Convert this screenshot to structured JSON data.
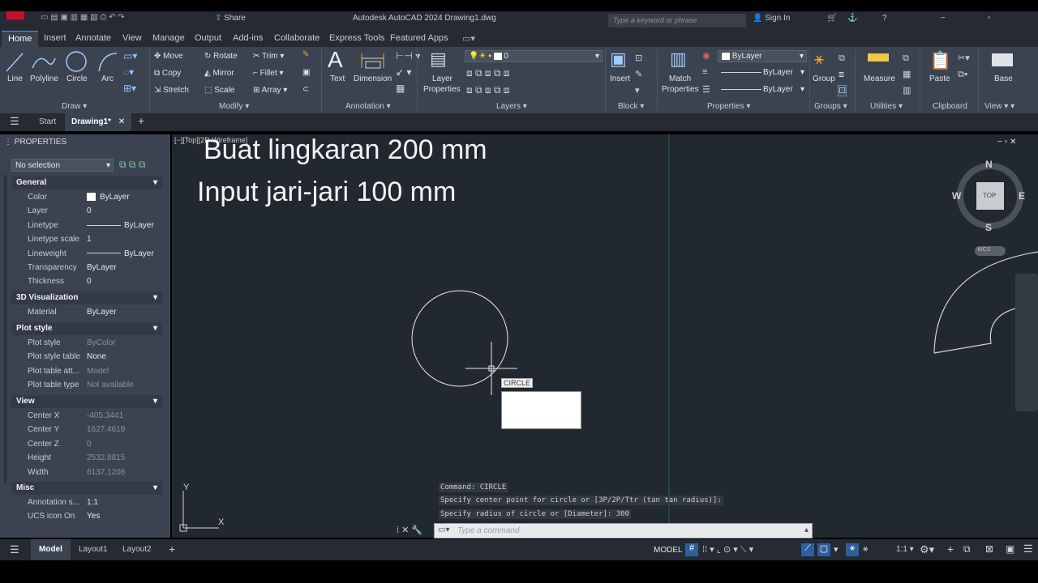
{
  "title_bar": {
    "share": "Share",
    "app_title": "Autodesk AutoCAD 2024   Drawing1.dwg",
    "search_placeholder": "Type a keyword or phrase",
    "sign_in": "Sign In"
  },
  "menu_tabs": [
    "Home",
    "Insert",
    "Annotate",
    "View",
    "Manage",
    "Output",
    "Add-ins",
    "Collaborate",
    "Express Tools",
    "Featured Apps"
  ],
  "ribbon": {
    "draw": {
      "line": "Line",
      "polyline": "Polyline",
      "circle": "Circle",
      "arc": "Arc",
      "title": "Draw"
    },
    "modify": {
      "move": "Move",
      "rotate": "Rotate",
      "trim": "Trim",
      "copy": "Copy",
      "mirror": "Mirror",
      "fillet": "Fillet",
      "stretch": "Stretch",
      "scale": "Scale",
      "array": "Array",
      "title": "Modify"
    },
    "annotation": {
      "text": "Text",
      "dimension": "Dimension",
      "title": "Annotation"
    },
    "layers": {
      "layer_properties_1": "Layer",
      "layer_properties_2": "Properties",
      "current_layer": "0",
      "title": "Layers"
    },
    "block": {
      "insert": "Insert",
      "title": "Block"
    },
    "properties": {
      "match_1": "Match",
      "match_2": "Properties",
      "color": "ByLayer",
      "linetype": "ByLayer",
      "lineweight": "ByLayer",
      "title": "Properties"
    },
    "groups": {
      "group": "Group",
      "title": "Groups"
    },
    "utilities": {
      "measure": "Measure",
      "title": "Utilities"
    },
    "clipboard": {
      "paste": "Paste",
      "title": "Clipboard"
    },
    "view": {
      "base": "Base",
      "title": "View"
    }
  },
  "doc_tabs": {
    "start": "Start",
    "drawing": "Drawing1*"
  },
  "properties": {
    "title": "PROPERTIES",
    "selection": "No selection",
    "general": {
      "title": "General",
      "rows": [
        [
          "Color",
          "ByLayer"
        ],
        [
          "Layer",
          "0"
        ],
        [
          "Linetype",
          "ByLayer"
        ],
        [
          "Linetype scale",
          "1"
        ],
        [
          "Lineweight",
          "ByLayer"
        ],
        [
          "Transparency",
          "ByLayer"
        ],
        [
          "Thickness",
          "0"
        ]
      ]
    },
    "viz": {
      "title": "3D Visualization",
      "rows": [
        [
          "Material",
          "ByLayer"
        ]
      ]
    },
    "plot": {
      "title": "Plot style",
      "rows": [
        [
          "Plot style",
          "ByColor"
        ],
        [
          "Plot style table",
          "None"
        ],
        [
          "Plot table att...",
          "Model"
        ],
        [
          "Plot table type",
          "Not available"
        ]
      ]
    },
    "view": {
      "title": "View",
      "rows": [
        [
          "Center X",
          "-405.3441"
        ],
        [
          "Center Y",
          "1627.4619"
        ],
        [
          "Center Z",
          "0"
        ],
        [
          "Height",
          "2532.8815"
        ],
        [
          "Width",
          "6137.1206"
        ]
      ]
    },
    "misc": {
      "title": "Misc",
      "rows": [
        [
          "Annotation s...",
          "1:1"
        ],
        [
          "UCS icon On",
          "Yes"
        ]
      ]
    }
  },
  "canvas": {
    "viewport_label": "[−][Top][2D Wireframe]",
    "overlay_line1": "Buat lingkaran 200 mm",
    "overlay_line2": "Input jari-jari 100 mm",
    "tooltip": "CIRCLE",
    "viewcube": {
      "n": "N",
      "s": "S",
      "e": "E",
      "w": "W",
      "top": "TOP",
      "wcs": "WCS"
    },
    "ucs_y": "Y",
    "ucs_x": "X"
  },
  "command": {
    "history": [
      "Command: CIRCLE",
      "Specify center point for circle or [3P/2P/Ttr (tan tan radius)]:",
      "Specify radius of circle or [Diameter]: 300"
    ],
    "placeholder": "Type a command"
  },
  "status": {
    "model": "Model",
    "layout1": "Layout1",
    "layout2": "Layout2",
    "model_btn": "MODEL",
    "scale": "1:1"
  },
  "colors": {
    "accent": "#5a92d6",
    "ribbon": "#3b4350",
    "canvas": "#212830",
    "titlebar": "#252a33"
  }
}
